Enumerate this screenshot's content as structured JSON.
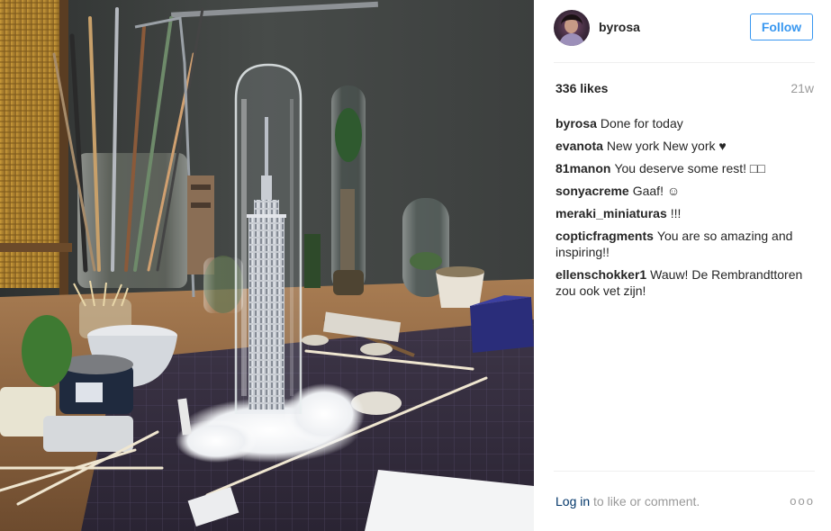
{
  "post": {
    "username": "byrosa",
    "follow_label": "Follow",
    "likes": "336 likes",
    "age": "21w",
    "comments": [
      {
        "author": "byrosa",
        "text": "Done for today"
      },
      {
        "author": "evanota",
        "text": "New york New york ♥"
      },
      {
        "author": "81manon",
        "text": "You deserve some rest! □□"
      },
      {
        "author": "sonyacreme",
        "text": "Gaaf! ☺"
      },
      {
        "author": "meraki_miniaturas",
        "text": "!!!"
      },
      {
        "author": "copticfragments",
        "text": "You are so amazing and inspiring!!"
      },
      {
        "author": "ellenschokker1",
        "text": "Wauw! De Rembrandttoren zou ook vet zijn!"
      }
    ],
    "footer": {
      "login_label": "Log in",
      "rest_label": " to like or comment.",
      "more_label": "ooo"
    }
  },
  "icons": {
    "avatar": "profile-avatar",
    "more": "more-options-icon"
  },
  "colors": {
    "link_blue": "#3897f0",
    "login_navy": "#003569",
    "muted_gray": "#999999",
    "text": "#262626"
  }
}
